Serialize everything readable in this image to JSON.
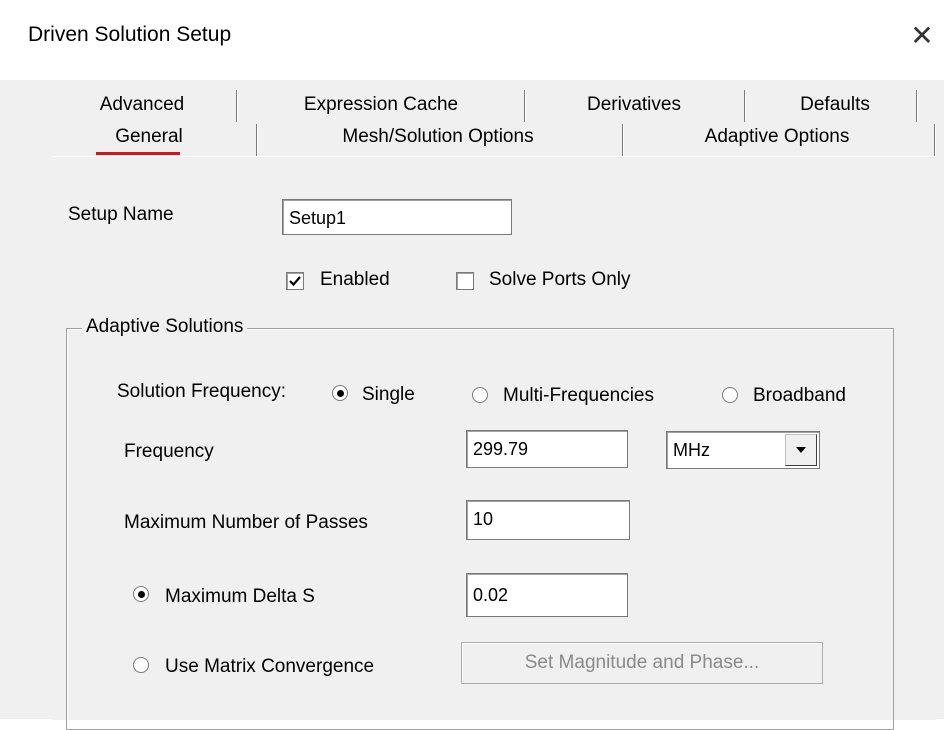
{
  "window": {
    "title": "Driven Solution Setup",
    "close_icon": "close-icon"
  },
  "tabs": {
    "back_row": [
      {
        "label": "Advanced"
      },
      {
        "label": "Expression Cache"
      },
      {
        "label": "Derivatives"
      },
      {
        "label": "Defaults"
      }
    ],
    "front_row": [
      {
        "label": "General",
        "selected": true
      },
      {
        "label": "Mesh/Solution Options"
      },
      {
        "label": "Adaptive Options"
      }
    ]
  },
  "general": {
    "setup_name_label": "Setup Name",
    "setup_name_value": "Setup1",
    "enabled_label": "Enabled",
    "enabled_checked": true,
    "solve_ports_only_label": "Solve Ports Only",
    "solve_ports_only_checked": false
  },
  "adaptive": {
    "group_title": "Adaptive Solutions",
    "solution_frequency_label": "Solution Frequency:",
    "freq_options": [
      {
        "label": "Single",
        "selected": true
      },
      {
        "label": "Multi-Frequencies",
        "selected": false
      },
      {
        "label": "Broadband",
        "selected": false
      }
    ],
    "frequency_label": "Frequency",
    "frequency_value": "299.79",
    "frequency_unit": "MHz",
    "max_passes_label": "Maximum Number of Passes",
    "max_passes_value": "10",
    "max_delta_s_label": "Maximum Delta S",
    "max_delta_s_selected": true,
    "max_delta_s_value": "0.02",
    "matrix_convergence_label": "Use Matrix Convergence",
    "matrix_convergence_selected": false,
    "set_mag_phase_label": "Set Magnitude and Phase..."
  },
  "colors": {
    "dialog_bg": "#f0f0f0",
    "title_bg": "#ffffff",
    "selected_tab_underline": "#d4141a",
    "disabled_text": "#8a8a8a"
  }
}
